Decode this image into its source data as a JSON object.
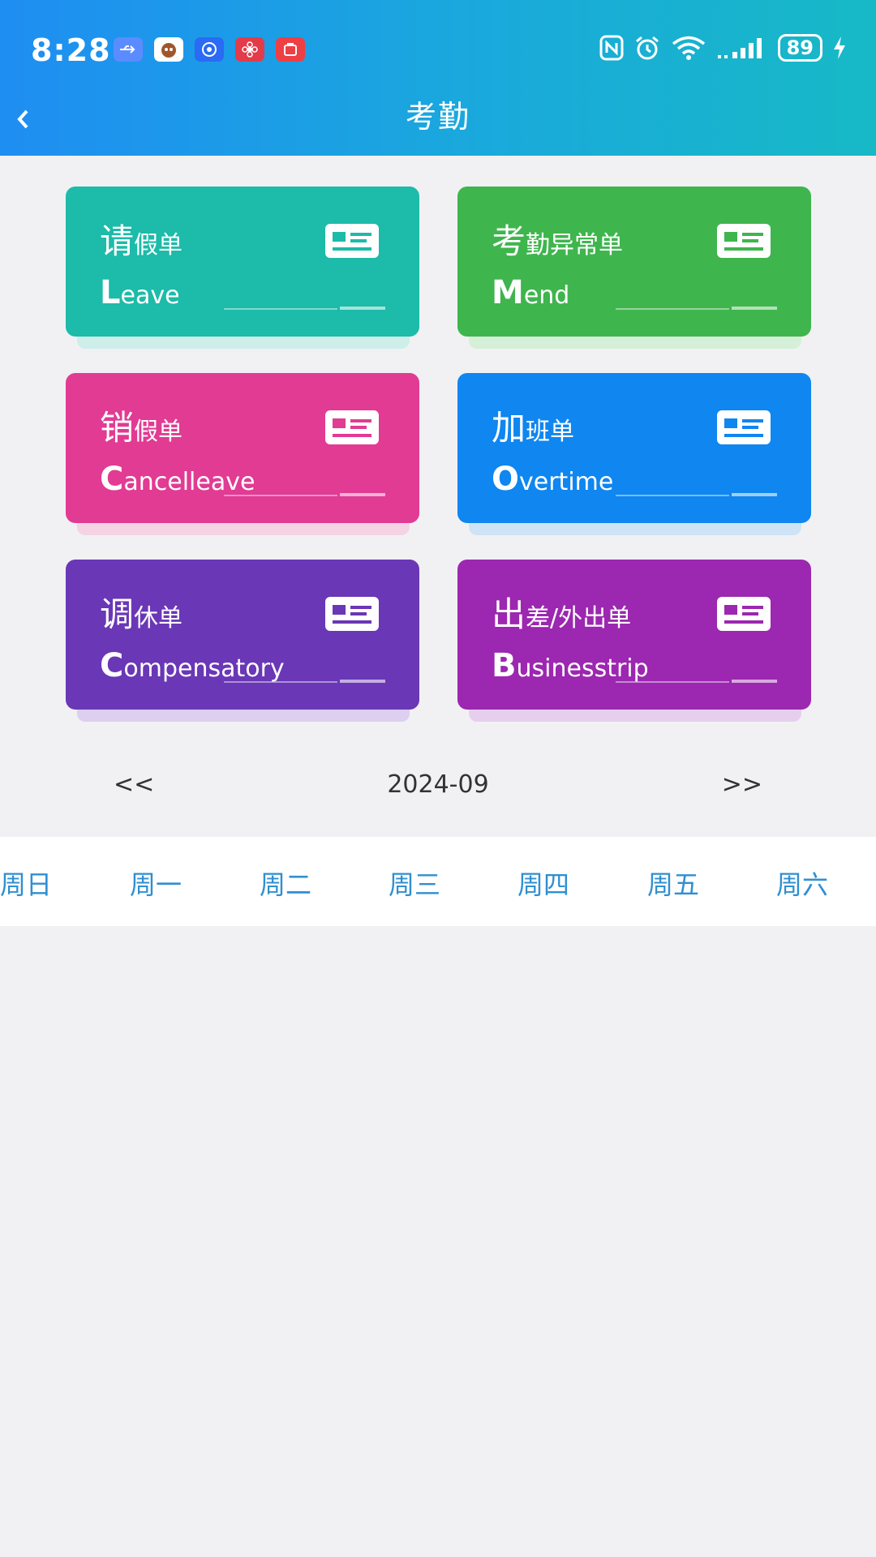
{
  "status_bar": {
    "time": "8:28",
    "battery": "89"
  },
  "nav": {
    "title": "考勤"
  },
  "cards": [
    {
      "title_first": "请",
      "title_rest": "假单",
      "sub_cap": "L",
      "sub_rest": "eave",
      "color": "#1dbba9",
      "shadow": "#cdeee9"
    },
    {
      "title_first": "考",
      "title_rest": "勤异常单",
      "sub_cap": "M",
      "sub_rest": "end",
      "color": "#3fb54d",
      "shadow": "#d6efd8"
    },
    {
      "title_first": "销",
      "title_rest": "假单",
      "sub_cap": "C",
      "sub_rest": "ancelleave",
      "color": "#e13b93",
      "shadow": "#f5d3e4"
    },
    {
      "title_first": "加",
      "title_rest": "班单",
      "sub_cap": "O",
      "sub_rest": "vertime",
      "color": "#0f86f0",
      "shadow": "#cfe3f7"
    },
    {
      "title_first": "调",
      "title_rest": "休单",
      "sub_cap": "C",
      "sub_rest": "ompensatory",
      "color": "#6a37b6",
      "shadow": "#dccff0"
    },
    {
      "title_first": "出",
      "title_rest": "差/外出单",
      "sub_cap": "B",
      "sub_rest": "usinesstrip",
      "color": "#9c27b0",
      "shadow": "#e6cfee"
    }
  ],
  "calendar": {
    "prev_label": "<<",
    "month": "2024-09",
    "next_label": ">>",
    "weekdays": [
      "周日",
      "周一",
      "周二",
      "周三",
      "周四",
      "周五",
      "周六"
    ]
  }
}
